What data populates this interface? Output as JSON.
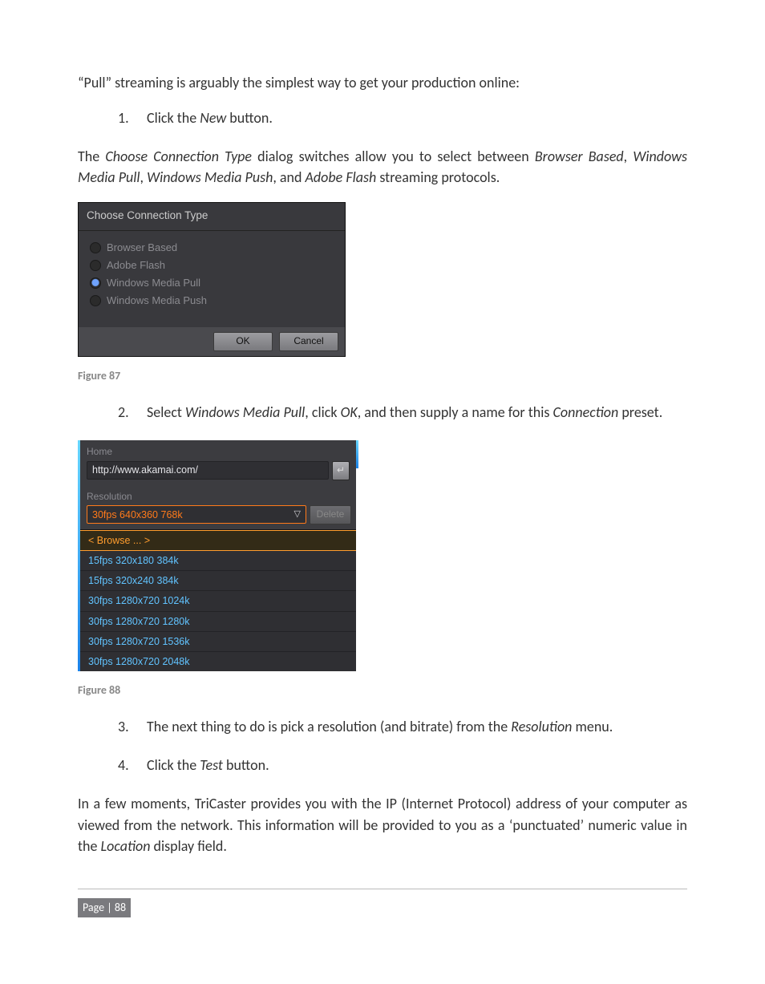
{
  "body": {
    "p1": "“Pull” streaming is arguably the simplest way to get your production online:",
    "li1": {
      "num": "1.",
      "pre": "Click the ",
      "em": "New",
      "post": " button."
    },
    "p2_pre": "The ",
    "p2_em1": "Choose Connection Type",
    "p2_mid1": " dialog switches allow you to select between ",
    "p2_em2": "Browser Based",
    "p2_mid2": ", ",
    "p2_em3": "Windows Media Pull",
    "p2_mid3": ", ",
    "p2_em4": "Windows Media Push",
    "p2_mid4": ", and ",
    "p2_em5": "Adobe Flash",
    "p2_post": " streaming protocols.",
    "li2_num": "2.",
    "li2_pre": "Select ",
    "li2_em1": "Windows Media Pull",
    "li2_mid1": ", click ",
    "li2_em2": "OK",
    "li2_mid2": ", and then supply a name for this ",
    "li2_em3": "Connection",
    "li2_post": " preset.",
    "li3": {
      "num": "3.",
      "pre": "The next thing to do is pick a resolution (and bitrate) from the ",
      "em": "Resolution",
      "post": " menu."
    },
    "li4": {
      "num": "4.",
      "pre": "Click the ",
      "em": "Test",
      "post": " button."
    },
    "p3_1": "In a few moments, TriCaster provides you with the IP (Internet Protocol) address of your ",
    "p3_2": "computer as viewed from the network.  This information will be provided to you as a ",
    "p3_3": "‘punctuated’ numeric value in the ",
    "p3_em": "Location",
    "p3_4": " display field."
  },
  "dlg1": {
    "title": "Choose Connection Type",
    "opts": [
      "Browser Based",
      "Adobe Flash",
      "Windows Media Pull",
      "Windows Media Push"
    ],
    "selected_index": 2,
    "ok": "OK",
    "cancel": "Cancel"
  },
  "fig87": "Figure 87",
  "pn2": {
    "home_label": "Home",
    "home_value": "http://www.akamai.com/",
    "res_label": "Resolution",
    "res_value": "30fps 640x360 768k",
    "delete": "Delete",
    "browse": "< Browse ... >",
    "items": [
      "15fps 320x180 384k",
      "15fps 320x240 384k",
      "30fps 1280x720 1024k",
      "30fps 1280x720 1280k",
      "30fps 1280x720 1536k",
      "30fps 1280x720 2048k"
    ]
  },
  "fig88": "Figure 88",
  "footer": {
    "page_label": "Page | 88"
  }
}
